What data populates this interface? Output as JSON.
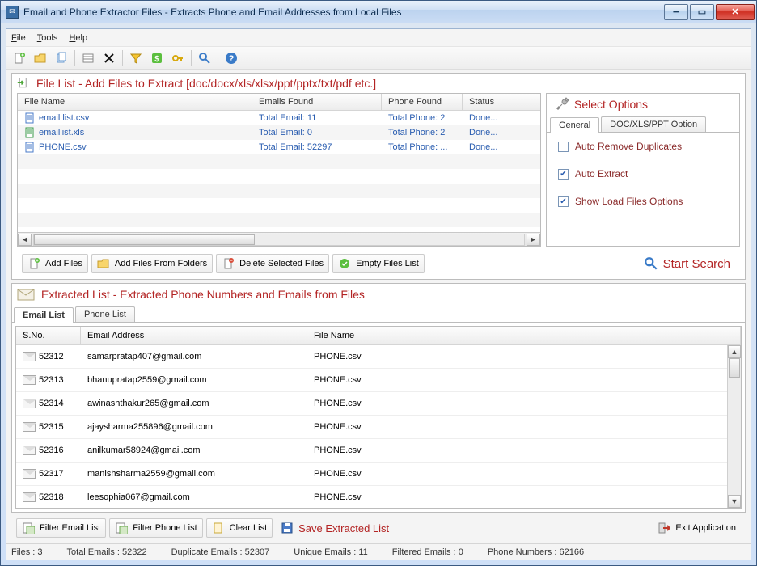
{
  "window": {
    "title": "Email and Phone Extractor Files  -  Extracts Phone and Email Addresses from Local Files"
  },
  "menu": {
    "file": "File",
    "tools": "Tools",
    "help": "Help"
  },
  "section_file": {
    "title": "File List - Add Files to Extract  [doc/docx/xls/xlsx/ppt/pptx/txt/pdf etc.]",
    "columns": {
      "c0": "File Name",
      "c1": "Emails Found",
      "c2": "Phone Found",
      "c3": "Status"
    },
    "rows": [
      {
        "name": "email list.csv",
        "emails": "Total Email: 11",
        "phones": "Total Phone: 2",
        "status": "Done..."
      },
      {
        "name": "emaillist.xls",
        "emails": "Total Email: 0",
        "phones": "Total Phone: 2",
        "status": "Done..."
      },
      {
        "name": "PHONE.csv",
        "emails": "Total Email: 52297",
        "phones": "Total Phone: ...",
        "status": "Done..."
      }
    ]
  },
  "options": {
    "title": "Select Options",
    "tab_general": "General",
    "tab_doc": "DOC/XLS/PPT Option",
    "opt1": "Auto Remove Duplicates",
    "opt2": "Auto Extract",
    "opt3": "Show Load Files Options"
  },
  "filebar": {
    "add": "Add Files",
    "addfolder": "Add Files From Folders",
    "delete": "Delete Selected Files",
    "empty": "Empty Files List",
    "start": "Start Search"
  },
  "section_ext": {
    "title": "Extracted List - Extracted Phone Numbers and Emails from Files",
    "tab_email": "Email List",
    "tab_phone": "Phone List",
    "columns": {
      "c0": "S.No.",
      "c1": "Email Address",
      "c2": "File Name"
    },
    "rows": [
      {
        "sno": "52312",
        "email": "samarpratap407@gmail.com",
        "file": "PHONE.csv"
      },
      {
        "sno": "52313",
        "email": "bhanupratap2559@gmail.com",
        "file": "PHONE.csv"
      },
      {
        "sno": "52314",
        "email": "awinashthakur265@gmail.com",
        "file": "PHONE.csv"
      },
      {
        "sno": "52315",
        "email": "ajaysharma255896@gmail.com",
        "file": "PHONE.csv"
      },
      {
        "sno": "52316",
        "email": "anilkumar58924@gmail.com",
        "file": "PHONE.csv"
      },
      {
        "sno": "52317",
        "email": "manishsharma2559@gmail.com",
        "file": "PHONE.csv"
      },
      {
        "sno": "52318",
        "email": "leesophia067@gmail.com",
        "file": "PHONE.csv"
      }
    ]
  },
  "bottombar": {
    "filter_email": "Filter Email List",
    "filter_phone": "Filter Phone List",
    "clear": "Clear List",
    "save": "Save Extracted List",
    "exit": "Exit Application"
  },
  "status": {
    "files": "Files :  3",
    "total": "Total Emails :  52322",
    "dup": "Duplicate Emails :  52307",
    "unique": "Unique Emails :  11",
    "filtered": "Filtered Emails :  0",
    "phones": "Phone Numbers :  62166"
  }
}
